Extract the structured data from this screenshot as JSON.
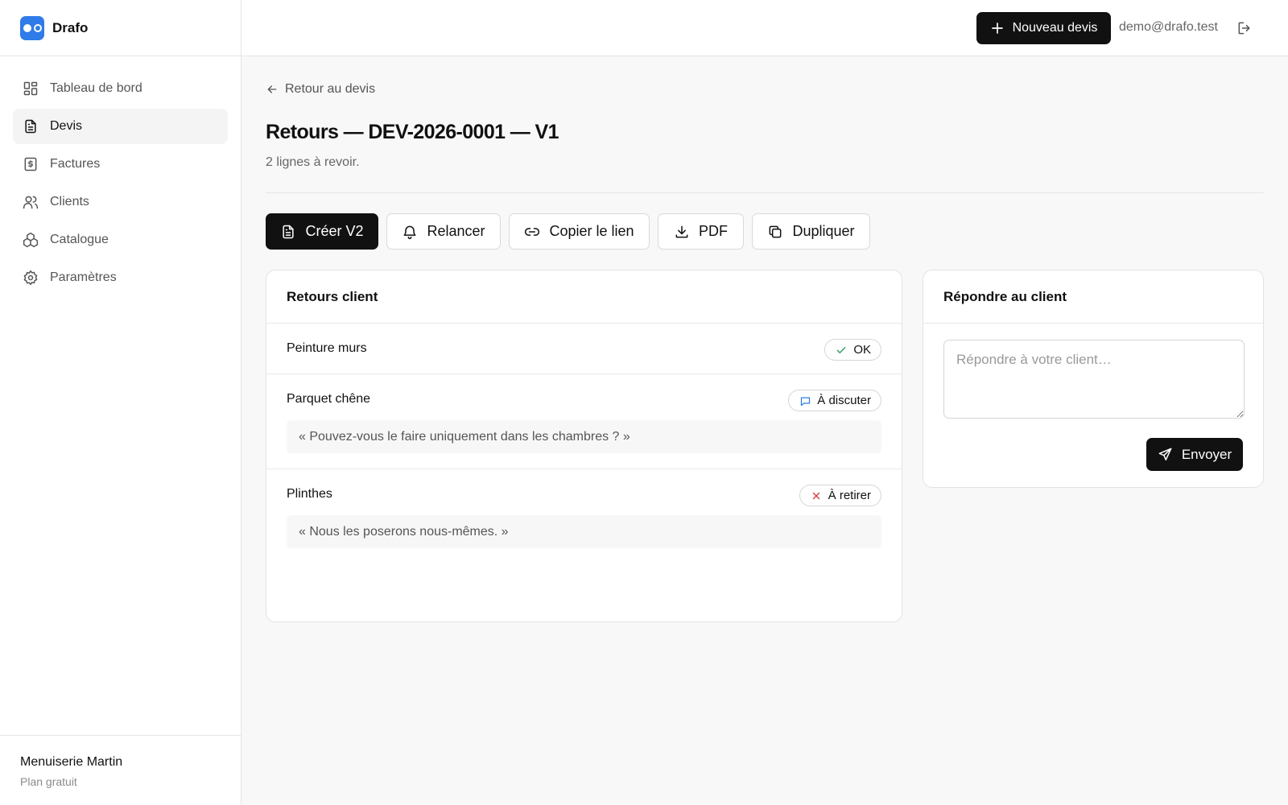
{
  "app": {
    "name": "Drafo"
  },
  "sidebar": {
    "items": [
      {
        "label": "Tableau de bord",
        "icon": "dashboard-icon",
        "active": false
      },
      {
        "label": "Devis",
        "icon": "document-icon",
        "active": true
      },
      {
        "label": "Factures",
        "icon": "invoice-icon",
        "active": false
      },
      {
        "label": "Clients",
        "icon": "users-icon",
        "active": false
      },
      {
        "label": "Catalogue",
        "icon": "catalog-icon",
        "active": false
      },
      {
        "label": "Paramètres",
        "icon": "gear-icon",
        "active": false
      }
    ],
    "org_name": "Menuiserie Martin",
    "org_plan": "Plan gratuit"
  },
  "topbar": {
    "new_quote_label": "Nouveau devis",
    "user_email": "demo@drafo.test"
  },
  "page": {
    "back_label": "Retour au devis",
    "title": "Retours — DEV-2026-0001 — V1",
    "subtitle": "2 lignes à revoir."
  },
  "actions": {
    "create_v2": "Créer V2",
    "remind": "Relancer",
    "copy_link": "Copier le lien",
    "pdf": "PDF",
    "duplicate": "Dupliquer"
  },
  "feedback": {
    "title": "Retours client",
    "rows": [
      {
        "name": "Peinture murs",
        "status": "OK",
        "status_icon": "check-icon",
        "comment": ""
      },
      {
        "name": "Parquet chêne",
        "status": "À discuter",
        "status_icon": "message-icon",
        "comment": "« Pouvez-vous le faire uniquement dans les chambres ? »"
      },
      {
        "name": "Plinthes",
        "status": "À retirer",
        "status_icon": "close-icon",
        "comment": "« Nous les poserons nous-mêmes. »"
      }
    ]
  },
  "reply": {
    "title": "Répondre au client",
    "placeholder": "Répondre à votre client…",
    "send_label": "Envoyer"
  },
  "colors": {
    "brand": "#2f7be8",
    "primary": "#111111",
    "ok": "#2e9b5f",
    "discuss": "#2f7be8",
    "remove": "#d93a3a"
  }
}
